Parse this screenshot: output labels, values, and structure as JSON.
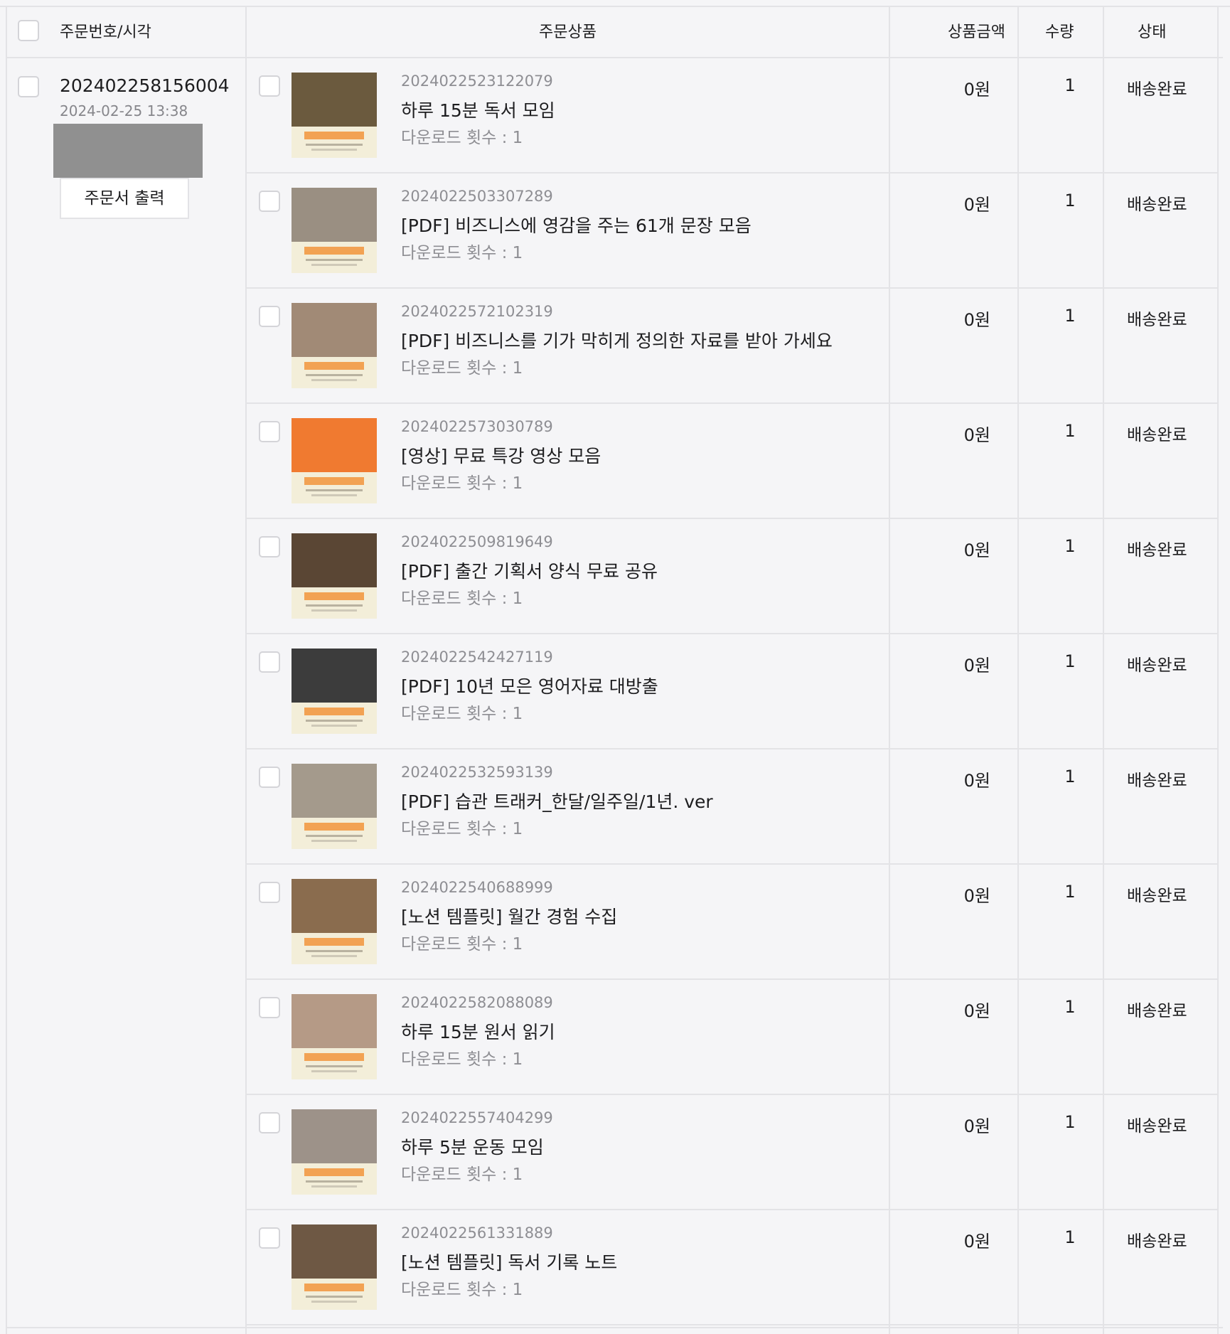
{
  "header": {
    "col_order": "주문번호/시각",
    "col_product": "주문상품",
    "col_price": "상품금액",
    "col_qty": "수량",
    "col_status": "상태"
  },
  "order": {
    "number": "202402258156004",
    "time": "2024-02-25 13:38",
    "print_button": "주문서 출력"
  },
  "items": [
    {
      "code": "2024022523122079",
      "name": "하루 15분 독서 모임",
      "downloads": "다운로드 횟수 : 1",
      "price": "0원",
      "qty": "1",
      "status": "배송완료",
      "thumb_color": "#6b5a3e"
    },
    {
      "code": "2024022503307289",
      "name": "[PDF] 비즈니스에 영감을 주는 61개 문장 모음",
      "downloads": "다운로드 횟수 : 1",
      "price": "0원",
      "qty": "1",
      "status": "배송완료",
      "thumb_color": "#9a8f82"
    },
    {
      "code": "2024022572102319",
      "name": "[PDF] 비즈니스를 기가 막히게 정의한 자료를 받아 가세요",
      "downloads": "다운로드 횟수 : 1",
      "price": "0원",
      "qty": "1",
      "status": "배송완료",
      "thumb_color": "#a18a76"
    },
    {
      "code": "2024022573030789",
      "name": "[영상] 무료 특강 영상 모음",
      "downloads": "다운로드 횟수 : 1",
      "price": "0원",
      "qty": "1",
      "status": "배송완료",
      "thumb_color": "#f07a30"
    },
    {
      "code": "2024022509819649",
      "name": "[PDF] 출간 기획서 양식 무료 공유",
      "downloads": "다운로드 횟수 : 1",
      "price": "0원",
      "qty": "1",
      "status": "배송완료",
      "thumb_color": "#5a4634"
    },
    {
      "code": "2024022542427119",
      "name": "[PDF] 10년 모은 영어자료 대방출",
      "downloads": "다운로드 횟수 : 1",
      "price": "0원",
      "qty": "1",
      "status": "배송완료",
      "thumb_color": "#3c3c3c"
    },
    {
      "code": "2024022532593139",
      "name": "[PDF] 습관 트래커_한달/일주일/1년. ver",
      "downloads": "다운로드 횟수 : 1",
      "price": "0원",
      "qty": "1",
      "status": "배송완료",
      "thumb_color": "#a49a8c"
    },
    {
      "code": "2024022540688999",
      "name": "[노션 템플릿] 월간 경험 수집",
      "downloads": "다운로드 횟수 : 1",
      "price": "0원",
      "qty": "1",
      "status": "배송완료",
      "thumb_color": "#8a6c4e"
    },
    {
      "code": "2024022582088089",
      "name": "하루 15분 원서 읽기",
      "downloads": "다운로드 횟수 : 1",
      "price": "0원",
      "qty": "1",
      "status": "배송완료",
      "thumb_color": "#b59a86"
    },
    {
      "code": "2024022557404299",
      "name": "하루 5분 운동 모임",
      "downloads": "다운로드 횟수 : 1",
      "price": "0원",
      "qty": "1",
      "status": "배송완료",
      "thumb_color": "#9d9289"
    },
    {
      "code": "2024022561331889",
      "name": "[노션 템플릿] 독서 기록 노트",
      "downloads": "다운로드 횟수 : 1",
      "price": "0원",
      "qty": "1",
      "status": "배송완료",
      "thumb_color": "#6e5844"
    }
  ]
}
